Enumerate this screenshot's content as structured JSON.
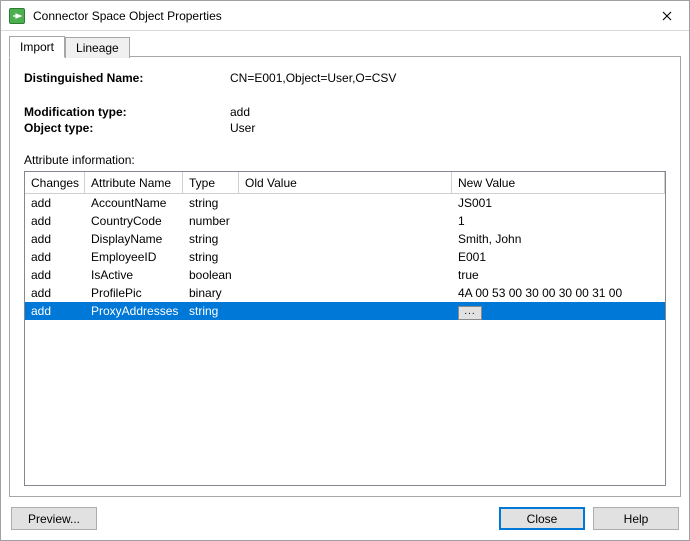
{
  "window": {
    "title": "Connector Space Object Properties"
  },
  "tabs": {
    "import": "Import",
    "lineage": "Lineage"
  },
  "props": {
    "dn_label": "Distinguished Name:",
    "dn_value": "CN=E001,Object=User,O=CSV",
    "mod_label": "Modification type:",
    "mod_value": "add",
    "obj_label": "Object type:",
    "obj_value": "User"
  },
  "section_label": "Attribute information:",
  "columns": {
    "changes": "Changes",
    "attr": "Attribute Name",
    "type": "Type",
    "old": "Old Value",
    "new": "New Value"
  },
  "rows": [
    {
      "changes": "add",
      "attr": "AccountName",
      "type": "string",
      "old": "",
      "new": "JS001",
      "selected": false
    },
    {
      "changes": "add",
      "attr": "CountryCode",
      "type": "number",
      "old": "",
      "new": "1",
      "selected": false
    },
    {
      "changes": "add",
      "attr": "DisplayName",
      "type": "string",
      "old": "",
      "new": "Smith, John",
      "selected": false
    },
    {
      "changes": "add",
      "attr": "EmployeeID",
      "type": "string",
      "old": "",
      "new": "E001",
      "selected": false
    },
    {
      "changes": "add",
      "attr": "IsActive",
      "type": "boolean",
      "old": "",
      "new": "true",
      "selected": false
    },
    {
      "changes": "add",
      "attr": "ProfilePic",
      "type": "binary",
      "old": "",
      "new": "4A 00 53 00 30 00 30 00 31 00",
      "selected": false
    },
    {
      "changes": "add",
      "attr": "ProxyAddresses",
      "type": "string",
      "old": "",
      "new": "",
      "selected": true,
      "ellipsis": true
    }
  ],
  "buttons": {
    "preview": "Preview...",
    "close": "Close",
    "help": "Help"
  }
}
